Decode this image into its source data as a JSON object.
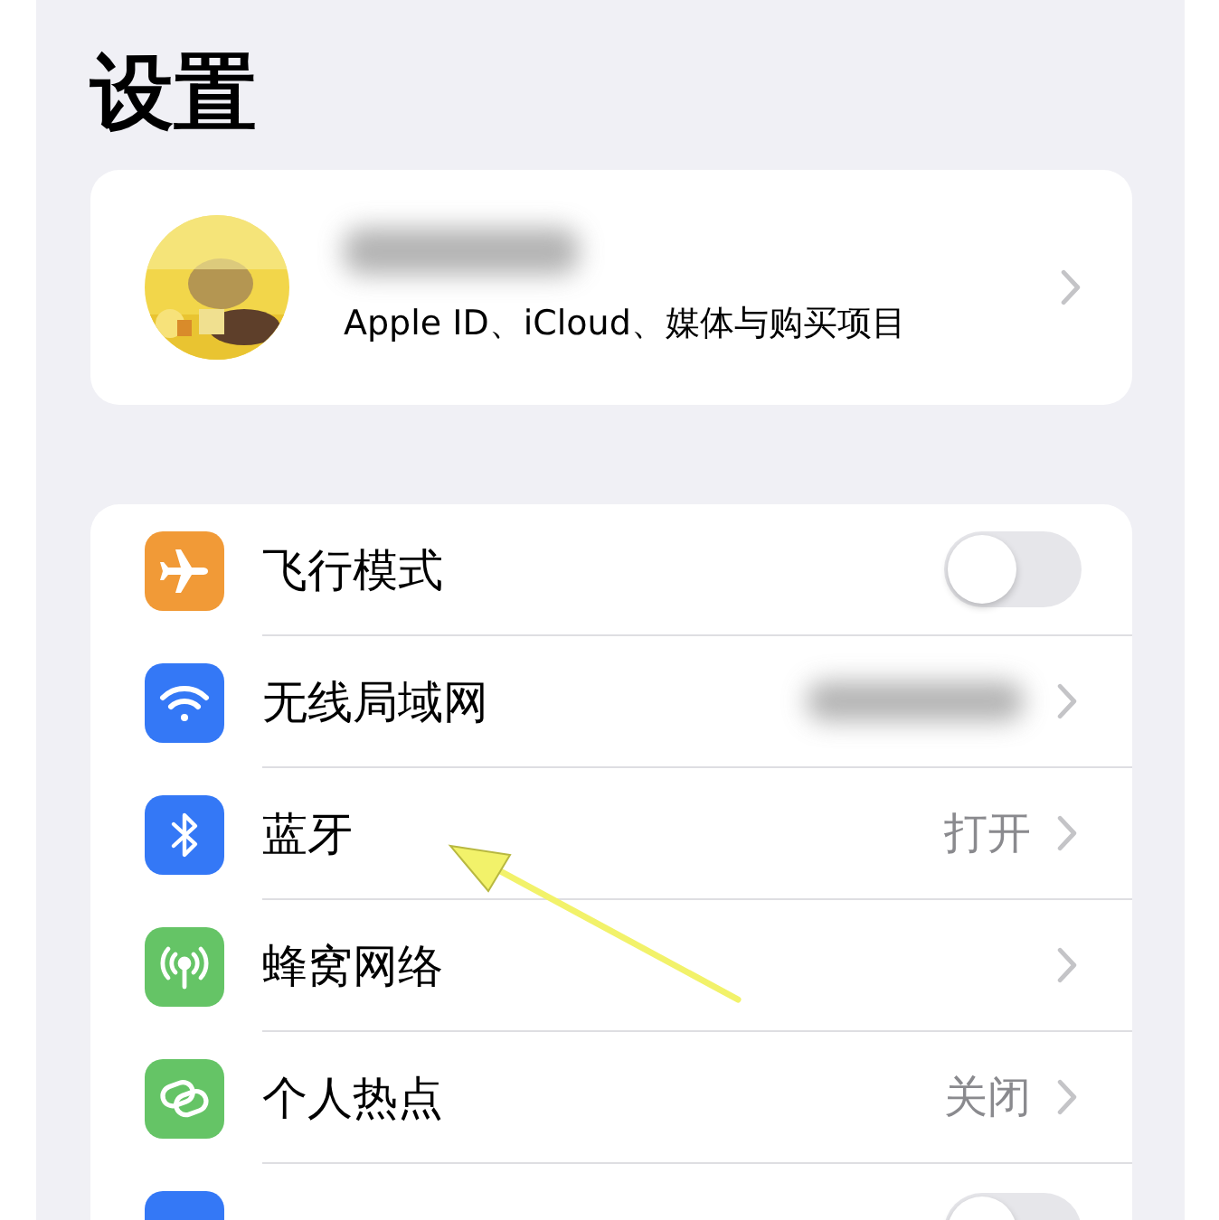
{
  "title": "设置",
  "profile": {
    "subtitle": "Apple ID、iCloud、媒体与购买项目"
  },
  "settings": [
    {
      "kind": "toggle",
      "color": "#f19a37",
      "label": "飞行模式",
      "on": false
    },
    {
      "kind": "blurred",
      "color": "#3478f6",
      "label": "无线局域网"
    },
    {
      "kind": "link",
      "color": "#3478f6",
      "label": "蓝牙",
      "value": "打开"
    },
    {
      "kind": "link",
      "color": "#65c466",
      "label": "蜂窝网络"
    },
    {
      "kind": "link",
      "color": "#65c466",
      "label": "个人热点",
      "value": "关闭"
    },
    {
      "kind": "toggle",
      "color": "#3478f6",
      "on": false
    }
  ],
  "annotations": [
    {
      "kind": "arrow",
      "color": "#f2f26a"
    }
  ]
}
